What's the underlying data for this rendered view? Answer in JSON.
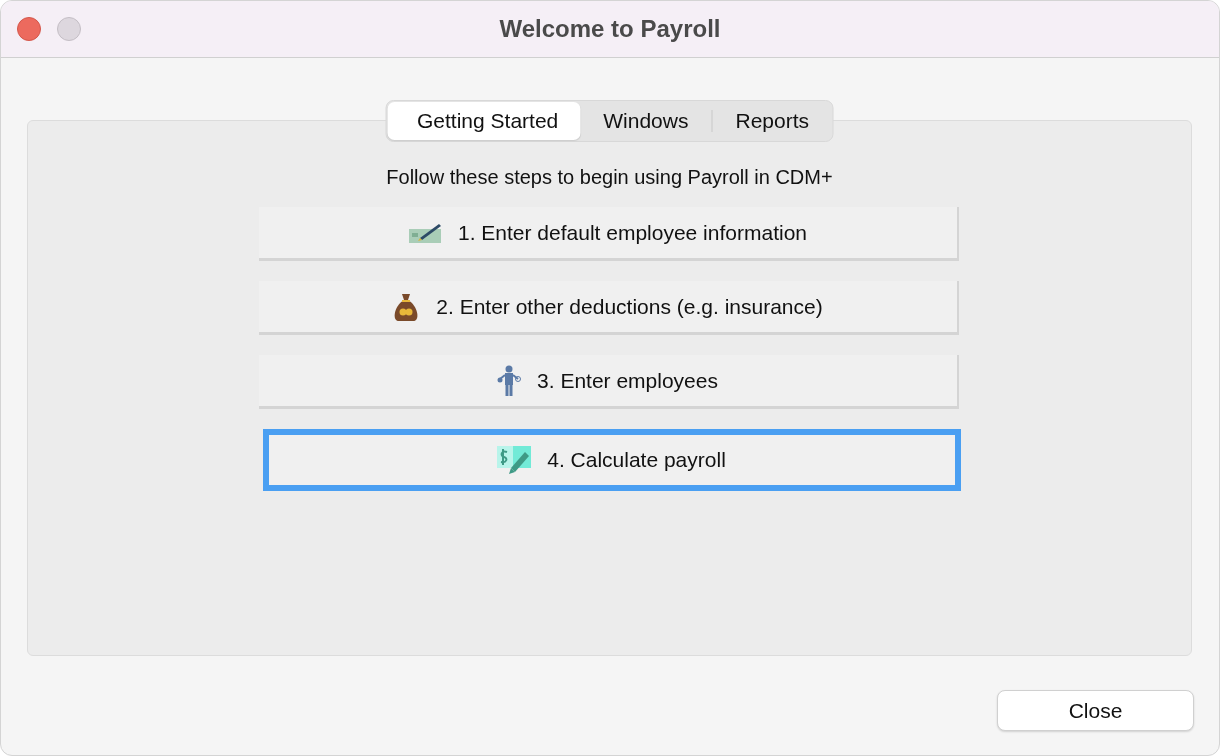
{
  "window": {
    "title": "Welcome to Payroll"
  },
  "tabs": [
    {
      "label": "Getting Started",
      "selected": true
    },
    {
      "label": "Windows",
      "selected": false
    },
    {
      "label": "Reports",
      "selected": false
    }
  ],
  "intro": "Follow these steps to begin using Payroll in CDM+",
  "steps": [
    {
      "label": "1. Enter default employee information",
      "kind": "check",
      "focused": false
    },
    {
      "label": "2. Enter other deductions (e.g. insurance)",
      "kind": "money-bag",
      "focused": false
    },
    {
      "label": "3. Enter employees",
      "kind": "person",
      "focused": false
    },
    {
      "label": "4. Calculate payroll",
      "kind": "dollar-pencil",
      "focused": true
    }
  ],
  "buttons": [
    "Close"
  ]
}
